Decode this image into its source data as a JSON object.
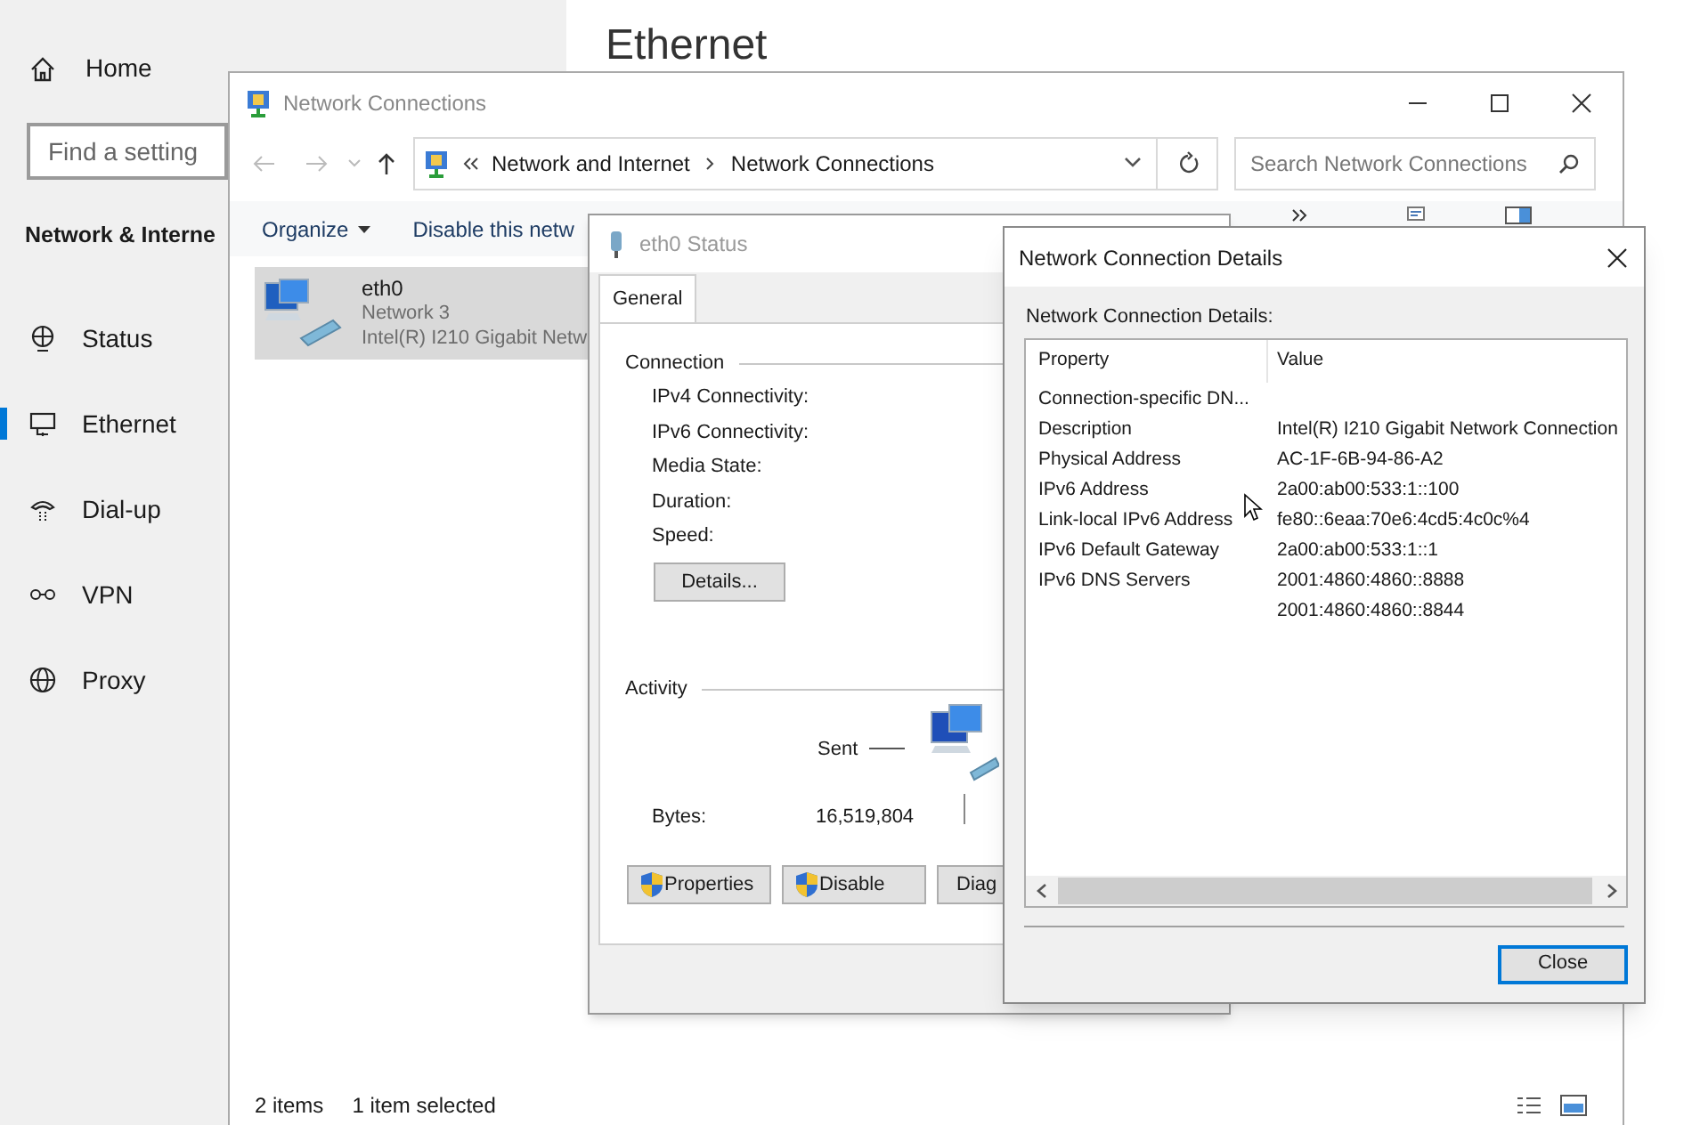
{
  "settings": {
    "home": "Home",
    "search": {
      "placeholder": "Find a setting"
    },
    "section_title": "Network & Interne",
    "page_title": "Ethernet",
    "items": [
      {
        "label": "Status",
        "kind": "status",
        "selected": false
      },
      {
        "label": "Ethernet",
        "kind": "ethernet",
        "selected": true
      },
      {
        "label": "Dial-up",
        "kind": "dialup",
        "selected": false
      },
      {
        "label": "VPN",
        "kind": "vpn",
        "selected": false
      },
      {
        "label": "Proxy",
        "kind": "proxy",
        "selected": false
      }
    ]
  },
  "explorer": {
    "title": "Network Connections",
    "breadcrumb": [
      "Network and Internet",
      "Network Connections"
    ],
    "search": {
      "placeholder": "Search Network Connections"
    },
    "toolbar": [
      {
        "label": "Organize",
        "dropdown": true
      },
      {
        "label": "Disable this netw",
        "dropdown": false
      }
    ],
    "items": [
      {
        "name": "eth0",
        "network": "Network 3",
        "device": "Intel(R) I210 Gigabit Netw",
        "selected": true
      }
    ],
    "status_bar": {
      "count": "2 items",
      "selection": "1 item selected"
    }
  },
  "status_dialog": {
    "title": "eth0 Status",
    "tabs": [
      {
        "label": "General",
        "selected": true
      }
    ],
    "connection_title": "Connection",
    "fields": [
      "IPv4 Connectivity:",
      "IPv6 Connectivity:",
      "Media State:",
      "Duration:",
      "Speed:"
    ],
    "details_button": "Details...",
    "activity_title": "Activity",
    "sent_label": "Sent",
    "bytes_label": "Bytes:",
    "bytes_sent": "16,519,804",
    "buttons": [
      {
        "label": "Properties",
        "shield": true
      },
      {
        "label": "Disable",
        "shield": true
      },
      {
        "label": "Diag",
        "shield": false
      }
    ]
  },
  "details_dialog": {
    "title": "Network Connection Details",
    "label": "Network Connection Details:",
    "columns": [
      "Property",
      "Value"
    ],
    "rows": [
      {
        "property": "Connection-specific DN..."
      },
      {
        "property": "Description",
        "values": [
          "Intel(R) I210 Gigabit Network Connection"
        ]
      },
      {
        "property": "Physical Address",
        "values": [
          "AC-1F-6B-94-86-A2"
        ]
      },
      {
        "property": "IPv6 Address",
        "values": [
          "2a00:ab00:533:1::100"
        ]
      },
      {
        "property": "Link-local IPv6 Address",
        "values": [
          "fe80::6eaa:70e6:4cd5:4c0c%4"
        ]
      },
      {
        "property": "IPv6 Default Gateway",
        "values": [
          "2a00:ab00:533:1::1"
        ]
      },
      {
        "property": "IPv6 DNS Servers",
        "values": [
          "2001:4860:4860::8888",
          "2001:4860:4860::8844"
        ]
      }
    ],
    "close_button": {
      "label": "Close",
      "default": true
    }
  }
}
